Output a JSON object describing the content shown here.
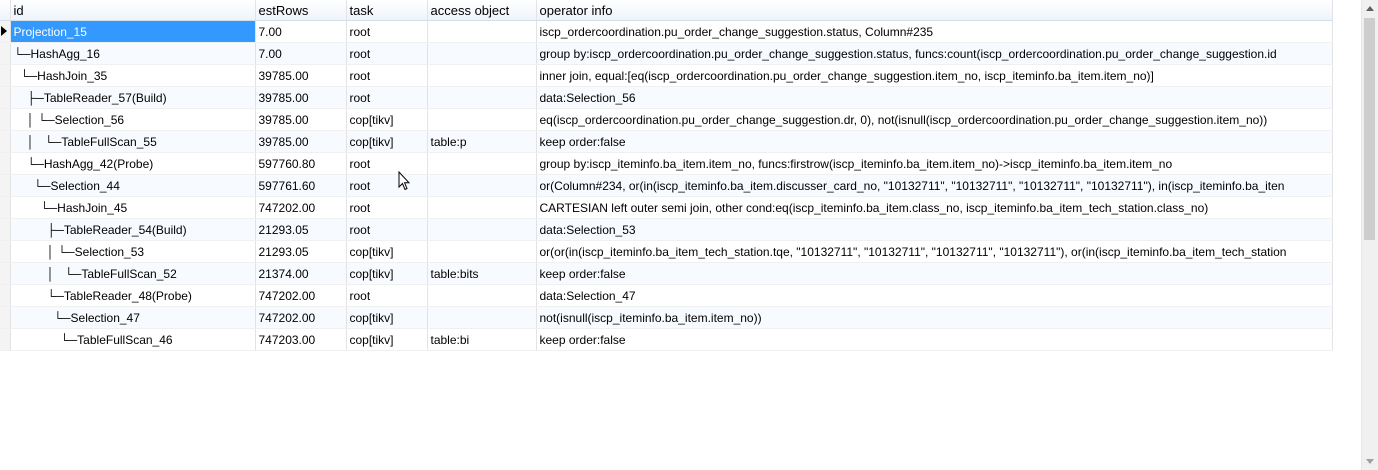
{
  "columns": {
    "id": "id",
    "est_rows": "estRows",
    "task": "task",
    "access_object": "access object",
    "operator_info": "operator info"
  },
  "rows": [
    {
      "id": "Projection_15",
      "est_rows": "7.00",
      "task": "root",
      "access_object": "",
      "operator_info": "iscp_ordercoordination.pu_order_change_suggestion.status, Column#235"
    },
    {
      "id": "└─HashAgg_16",
      "est_rows": "7.00",
      "task": "root",
      "access_object": "",
      "operator_info": "group by:iscp_ordercoordination.pu_order_change_suggestion.status, funcs:count(iscp_ordercoordination.pu_order_change_suggestion.id"
    },
    {
      "id": "  └─HashJoin_35",
      "est_rows": "39785.00",
      "task": "root",
      "access_object": "",
      "operator_info": "inner join, equal:[eq(iscp_ordercoordination.pu_order_change_suggestion.item_no, iscp_iteminfo.ba_item.item_no)]"
    },
    {
      "id": "    ├─TableReader_57(Build)",
      "est_rows": "39785.00",
      "task": "root",
      "access_object": "",
      "operator_info": "data:Selection_56"
    },
    {
      "id": "    │ └─Selection_56",
      "est_rows": "39785.00",
      "task": "cop[tikv]",
      "access_object": "",
      "operator_info": "eq(iscp_ordercoordination.pu_order_change_suggestion.dr, 0), not(isnull(iscp_ordercoordination.pu_order_change_suggestion.item_no))"
    },
    {
      "id": "    │   └─TableFullScan_55",
      "est_rows": "39785.00",
      "task": "cop[tikv]",
      "access_object": "table:p",
      "operator_info": "keep order:false"
    },
    {
      "id": "    └─HashAgg_42(Probe)",
      "est_rows": "597760.80",
      "task": "root",
      "access_object": "",
      "operator_info": "group by:iscp_iteminfo.ba_item.item_no, funcs:firstrow(iscp_iteminfo.ba_item.item_no)->iscp_iteminfo.ba_item.item_no"
    },
    {
      "id": "      └─Selection_44",
      "est_rows": "597761.60",
      "task": "root",
      "access_object": "",
      "operator_info": "or(Column#234, or(in(iscp_iteminfo.ba_item.discusser_card_no, \"10132711\", \"10132711\", \"10132711\", \"10132711\"), in(iscp_iteminfo.ba_iten"
    },
    {
      "id": "        └─HashJoin_45",
      "est_rows": "747202.00",
      "task": "root",
      "access_object": "",
      "operator_info": "CARTESIAN left outer semi join, other cond:eq(iscp_iteminfo.ba_item.class_no, iscp_iteminfo.ba_item_tech_station.class_no)"
    },
    {
      "id": "          ├─TableReader_54(Build)",
      "est_rows": "21293.05",
      "task": "root",
      "access_object": "",
      "operator_info": "data:Selection_53"
    },
    {
      "id": "          │ └─Selection_53",
      "est_rows": "21293.05",
      "task": "cop[tikv]",
      "access_object": "",
      "operator_info": "or(or(in(iscp_iteminfo.ba_item_tech_station.tqe, \"10132711\", \"10132711\", \"10132711\", \"10132711\"), or(in(iscp_iteminfo.ba_item_tech_station"
    },
    {
      "id": "          │   └─TableFullScan_52",
      "est_rows": "21374.00",
      "task": "cop[tikv]",
      "access_object": "table:bits",
      "operator_info": "keep order:false"
    },
    {
      "id": "          └─TableReader_48(Probe)",
      "est_rows": "747202.00",
      "task": "root",
      "access_object": "",
      "operator_info": "data:Selection_47"
    },
    {
      "id": "            └─Selection_47",
      "est_rows": "747202.00",
      "task": "cop[tikv]",
      "access_object": "",
      "operator_info": "not(isnull(iscp_iteminfo.ba_item.item_no))"
    },
    {
      "id": "              └─TableFullScan_46",
      "est_rows": "747203.00",
      "task": "cop[tikv]",
      "access_object": "table:bi",
      "operator_info": "keep order:false"
    }
  ],
  "selected_row": 0,
  "icons": {
    "row_marker": "current-row-arrow-icon",
    "scroll_up": "scroll-up-arrow-icon",
    "scroll_down": "scroll-down-arrow-icon",
    "cursor": "mouse-pointer-icon"
  },
  "colors": {
    "selection": "#3399ff",
    "alt_row": "#f7fbff",
    "header_gradient_end": "#eef4fb"
  }
}
